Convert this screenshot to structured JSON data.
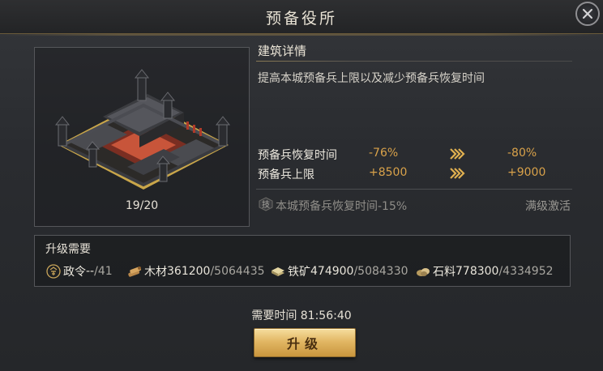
{
  "window": {
    "title": "预备役所"
  },
  "building": {
    "level": "19/20"
  },
  "detail": {
    "heading": "建筑详情",
    "description": "提高本城预备兵上限以及减少预备兵恢复时间",
    "stats": [
      {
        "label": "预备兵恢复时间",
        "current": "-76%",
        "next": "-80%"
      },
      {
        "label": "预备兵上限",
        "current": "+8500",
        "next": "+9000"
      }
    ],
    "bonus": {
      "icon_text": "技",
      "text": "本城预备兵恢复时间-15%",
      "status": "满级激活"
    }
  },
  "requirements": {
    "heading": "升级需要",
    "items": [
      {
        "icon": "decree-icon",
        "name": "政令",
        "have": "--",
        "need": "/41"
      },
      {
        "icon": "wood-icon",
        "name": "木材",
        "have": "361200",
        "need": "/5064435"
      },
      {
        "icon": "iron-icon",
        "name": "铁矿",
        "have": "474900",
        "need": "/5084330"
      },
      {
        "icon": "stone-icon",
        "name": "石料",
        "have": "778300",
        "need": "/4334952"
      }
    ]
  },
  "footer": {
    "time_label": "需要时间 81:56:40",
    "upgrade_label": "升级"
  },
  "colors": {
    "accent_gold": "#d9a24a",
    "button_gold": "#e2b764",
    "panel_bg": "#2a2c30"
  }
}
